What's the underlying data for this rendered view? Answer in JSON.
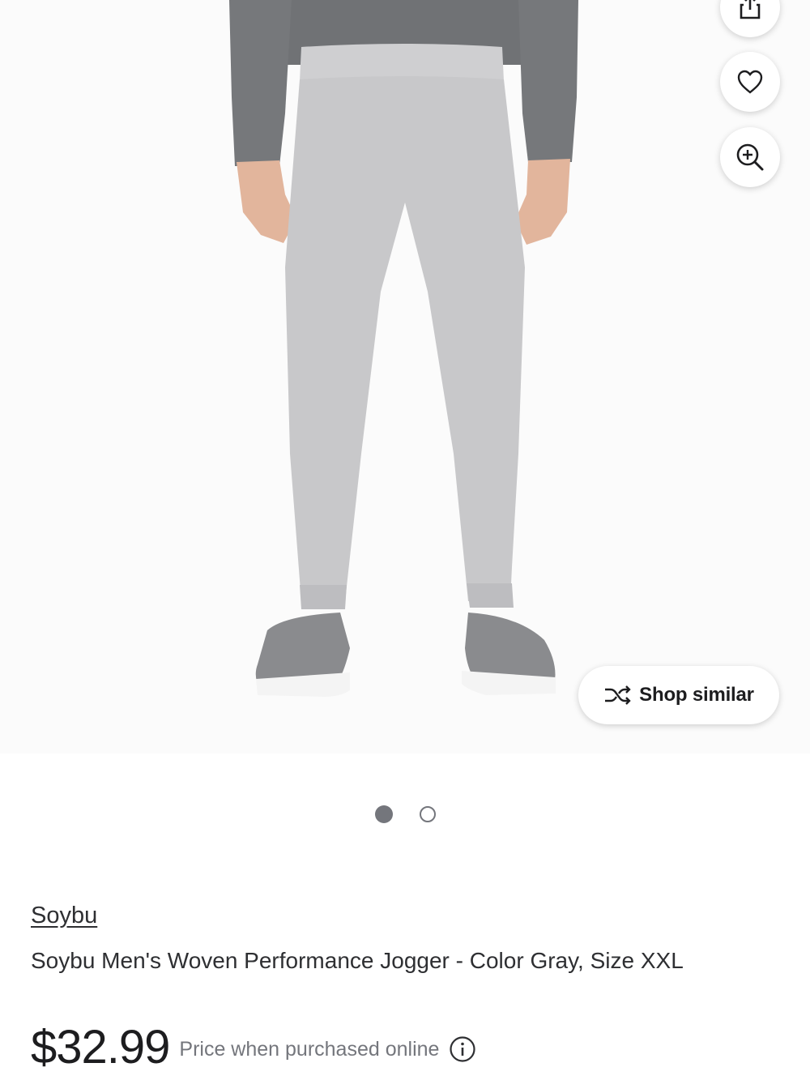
{
  "product": {
    "brand": "Soybu",
    "title": "Soybu Men's Woven Performance Jogger - Color Gray, Size XXL",
    "price": "$32.99",
    "price_note": "Price when purchased online"
  },
  "gallery": {
    "shop_similar_label": "Shop similar",
    "images_total": 2,
    "current_image": 1,
    "action_icons": [
      "share-icon",
      "heart-icon",
      "zoom-in-icon",
      "shuffle-icon"
    ]
  },
  "colors": {
    "text": "#2e2f32",
    "muted": "#74767c",
    "background": "#ffffff",
    "pant_gray": "#c7c7c9",
    "shirt_gray": "#7a7c7f"
  }
}
